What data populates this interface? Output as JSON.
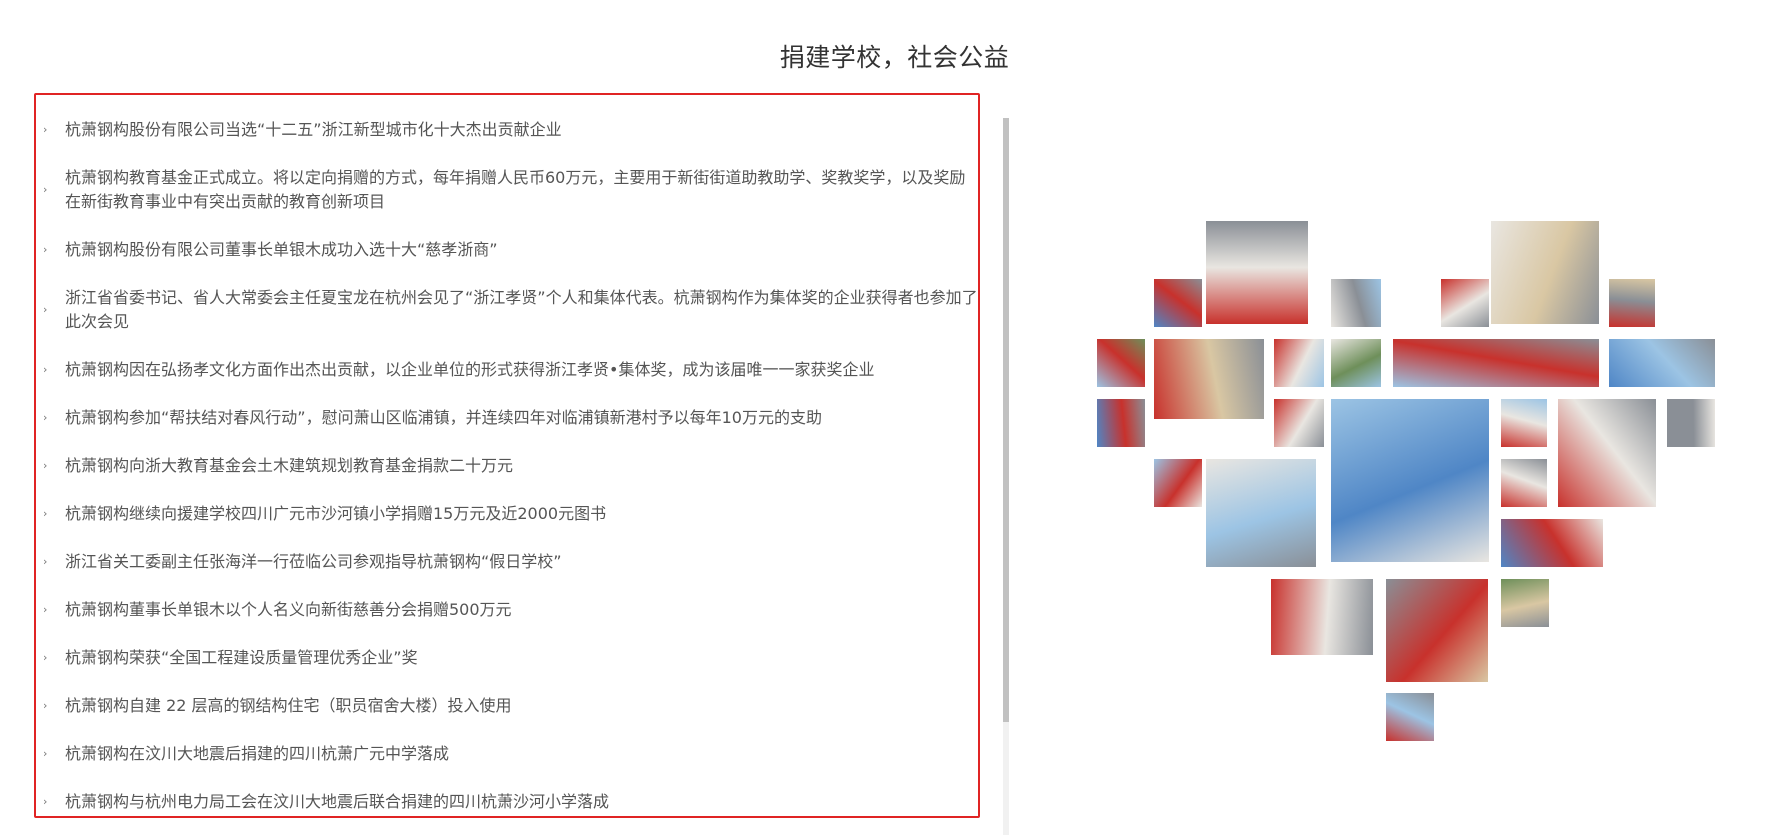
{
  "page": {
    "title": "捐建学校，社会公益"
  },
  "bullet_icon": "›",
  "news": [
    "杭萧钢构股份有限公司当选“十二五”浙江新型城市化十大杰出贡献企业",
    "杭萧钢构教育基金正式成立。将以定向捐赠的方式，每年捐赠人民币60万元，主要用于新街街道助教助学、奖教奖学，以及奖励在新街教育事业中有突出贡献的教育创新项目",
    "杭萧钢构股份有限公司董事长单银木成功入选十大“慈孝浙商”",
    "浙江省省委书记、省人大常委会主任夏宝龙在杭州会见了“浙江孝贤”个人和集体代表。杭萧钢构作为集体奖的企业获得者也参加了此次会见",
    "杭萧钢构因在弘扬孝文化方面作出杰出贡献，以企业单位的形式获得浙江孝贤•集体奖，成为该届唯一一家获奖企业",
    "杭萧钢构参加“帮扶结对春风行动”，慰问萧山区临浦镇，并连续四年对临浦镇新港村予以每年10万元的支助",
    "杭萧钢构向浙大教育基金会土木建筑规划教育基金捐款二十万元",
    "杭萧钢构继续向援建学校四川广元市沙河镇小学捐赠15万元及近2000元图书",
    "浙江省关工委副主任张海洋一行莅临公司参观指导杭萧钢构“假日学校”",
    "杭萧钢构董事长单银木以个人名义向新街慈善分会捐赠500万元",
    "杭萧钢构荣获“全国工程建设质量管理优秀企业”奖",
    "杭萧钢构自建 22 层高的钢结构住宅（职员宿舍大楼）投入使用",
    "杭萧钢构在汶川大地震后捐建的四川杭萧广元中学落成",
    "杭萧钢构与杭州电力局工会在汶川大地震后联合捐建的四川杭萧沙河小学落成"
  ],
  "collage_colors": {
    "red": "#c8312c",
    "blue": "#4f86c6",
    "green": "#6e8f5a",
    "white": "#e9e6e1",
    "sky": "#9cc4e4",
    "gray": "#8a8f96",
    "beige": "#d9c7a3"
  }
}
